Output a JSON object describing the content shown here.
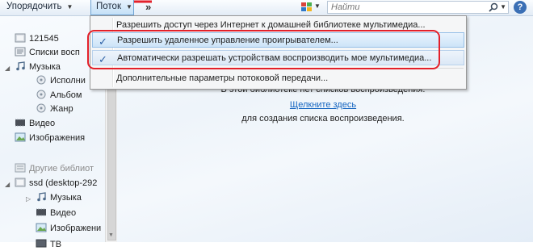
{
  "toolbar": {
    "organize_label": "Упорядочить",
    "stream_label": "Поток",
    "more_label": "»",
    "search_placeholder": "Найти"
  },
  "nav": {
    "items": [
      {
        "label": "121545"
      },
      {
        "label": "Списки восп"
      },
      {
        "label": "Музыка"
      },
      {
        "label": "Исполни"
      },
      {
        "label": "Альбом"
      },
      {
        "label": "Жанр"
      },
      {
        "label": "Видео"
      },
      {
        "label": "Изображения"
      },
      {
        "label": "Другие библиот"
      },
      {
        "label": "ssd (desktop-292"
      },
      {
        "label": "Музыка"
      },
      {
        "label": "Видео"
      },
      {
        "label": "Изображени"
      },
      {
        "label": "ТВ"
      }
    ]
  },
  "content": {
    "line1": "В этой библиотеке нет списков воспроизведения.",
    "link": "Щелкните здесь",
    "line3": "для создания списка воспроизведения."
  },
  "stream_menu": {
    "items": [
      {
        "label": "Разрешить доступ через Интернет к домашней библиотеке мультимедиа...",
        "checked": false
      },
      {
        "label": "Разрешить удаленное управление проигрывателем...",
        "checked": true
      },
      {
        "label": "Автоматически разрешать устройствам воспроизводить мое мультимедиа...",
        "checked": true
      },
      {
        "label": "Дополнительные параметры потоковой передачи...",
        "checked": false
      }
    ]
  },
  "colors": {
    "highlight": "#e3202a",
    "accent": "#3a6fb5",
    "link": "#1565c0"
  }
}
